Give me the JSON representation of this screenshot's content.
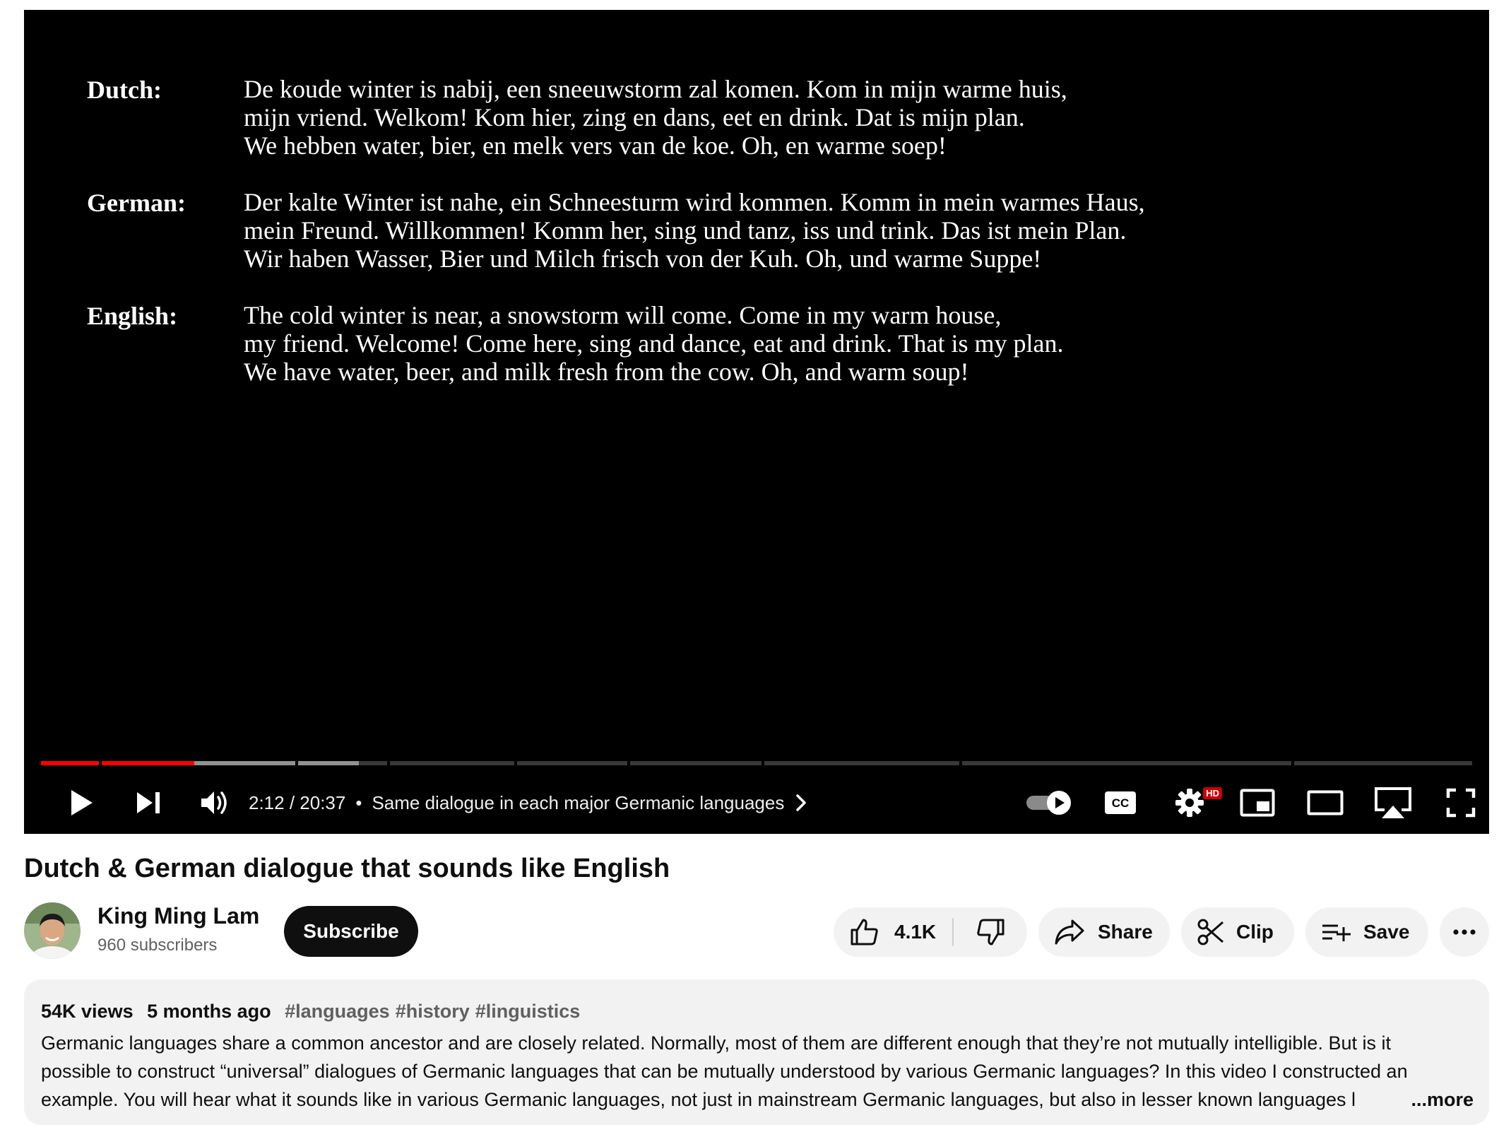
{
  "slide": {
    "blocks": [
      {
        "label": "Dutch:",
        "lines": [
          "De koude winter is nabij, een sneeuwstorm zal komen. Kom in mijn warme huis,",
          "mijn vriend. Welkom! Kom hier, zing en dans, eet en drink. Dat is mijn plan.",
          "We hebben water, bier, en melk vers van de koe. Oh, en warme soep!"
        ]
      },
      {
        "label": "German:",
        "lines": [
          "Der kalte Winter ist nahe, ein Schneesturm wird kommen. Komm in mein warmes Haus,",
          "mein Freund. Willkommen! Komm her, sing und tanz, iss und trink. Das ist mein Plan.",
          "Wir haben Wasser, Bier und Milch frisch von der Kuh. Oh, und warme Suppe!"
        ]
      },
      {
        "label": "English:",
        "lines": [
          "The cold winter is near, a snowstorm will come. Come in my warm house,",
          "my friend. Welcome! Come here, sing and dance, eat and drink. That is my plan.",
          "We have water, beer, and milk fresh from the cow. Oh, and warm soup!"
        ]
      }
    ]
  },
  "player": {
    "current_time": "2:12",
    "duration": "20:37",
    "time_display": "2:12 / 20:37",
    "chapter_separator": "•",
    "chapter_title": "Same dialogue in each major Germanic languages",
    "hd_badge": "HD",
    "progress_fraction": 0.107,
    "accent_color": "#ff0000"
  },
  "video": {
    "title": "Dutch & German dialogue that sounds like English"
  },
  "channel": {
    "name": "King Ming Lam",
    "subscribers": "960 subscribers",
    "subscribe_label": "Subscribe"
  },
  "actions": {
    "likes": "4.1K",
    "share_label": "Share",
    "clip_label": "Clip",
    "save_label": "Save"
  },
  "description": {
    "views": "54K views",
    "age": "5 months ago",
    "tags": [
      "#languages",
      "#history",
      "#linguistics"
    ],
    "lines": [
      "Germanic languages share a common ancestor and are closely related. Normally, most of them are different enough that they’re not mutually intelligible. But is it",
      "possible to construct “universal” dialogues of Germanic languages that can be mutually understood by various Germanic languages? In this video I constructed an",
      "example. You will hear what it sounds like in various Germanic languages, not just in mainstream Germanic languages, but also in lesser known languages l"
    ],
    "more_label": "...more"
  },
  "icons": {
    "play": "play-icon",
    "next": "next-icon",
    "volume": "volume-icon",
    "chapter_chevron": "chevron-right-icon",
    "autoplay": "autoplay-toggle-icon",
    "captions": "cc-icon",
    "settings": "gear-icon",
    "miniplayer": "miniplayer-icon",
    "theater": "theater-mode-icon",
    "airplay": "airplay-icon",
    "fullscreen": "fullscreen-icon",
    "like": "thumbs-up-icon",
    "dislike": "thumbs-down-icon",
    "share": "share-arrow-icon",
    "clip": "scissors-icon",
    "save": "playlist-add-icon",
    "more": "more-horizontal-icon"
  }
}
